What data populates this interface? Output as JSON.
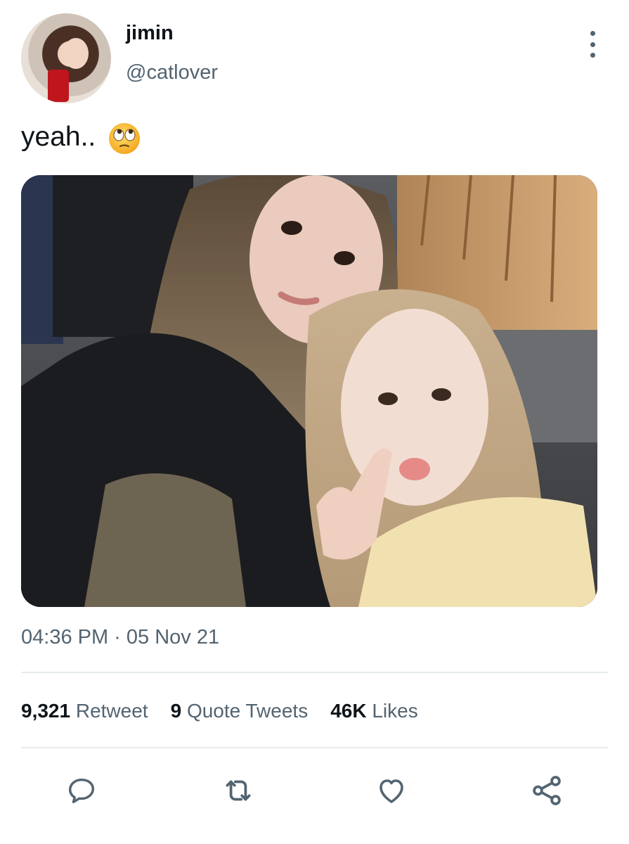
{
  "author": {
    "display_name": "jimin",
    "handle": "@catlover"
  },
  "tweet": {
    "text": "yeah..",
    "emoji": "face-with-rolling-eyes",
    "timestamp": "04:36 PM · 05 Nov 21"
  },
  "stats": {
    "retweets_count": "9,321",
    "retweets_label": "Retweet",
    "quotes_count": "9",
    "quotes_label": "Quote Tweets",
    "likes_count": "46K",
    "likes_label": "Likes"
  },
  "icons": {
    "more": "more-vertical-icon",
    "reply": "reply-icon",
    "retweet": "retweet-icon",
    "like": "heart-icon",
    "share": "share-icon"
  },
  "colors": {
    "text_primary": "#0f1419",
    "text_secondary": "#536471",
    "divider": "#e6ecf0"
  }
}
